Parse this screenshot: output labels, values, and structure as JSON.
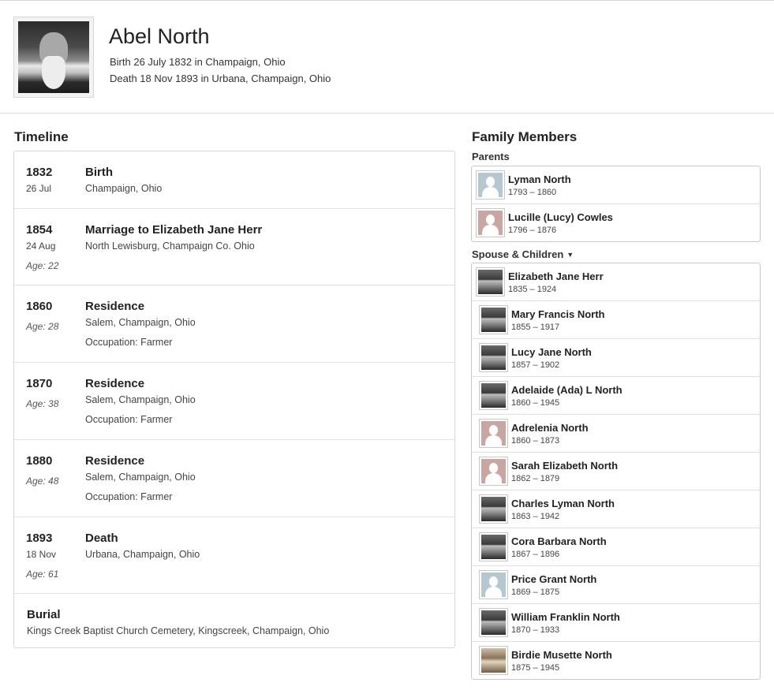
{
  "person": {
    "name": "Abel North",
    "birth": "Birth 26 July 1832 in Champaign, Ohio",
    "death": "Death 18 Nov 1893 in Urbana, Champaign, Ohio"
  },
  "timeline": {
    "title": "Timeline",
    "events": [
      {
        "year": "1832",
        "date": "26 Jul",
        "age": "",
        "title": "Birth",
        "place": "Champaign, Ohio",
        "occupation": ""
      },
      {
        "year": "1854",
        "date": "24 Aug",
        "age": "Age: 22",
        "title": "Marriage to Elizabeth Jane Herr",
        "place": "North Lewisburg, Champaign Co. Ohio",
        "occupation": ""
      },
      {
        "year": "1860",
        "date": "",
        "age": "Age: 28",
        "title": "Residence",
        "place": "Salem, Champaign, Ohio",
        "occupation": "Occupation: Farmer"
      },
      {
        "year": "1870",
        "date": "",
        "age": "Age: 38",
        "title": "Residence",
        "place": "Salem, Champaign, Ohio",
        "occupation": "Occupation: Farmer"
      },
      {
        "year": "1880",
        "date": "",
        "age": "Age: 48",
        "title": "Residence",
        "place": "Salem, Champaign, Ohio",
        "occupation": "Occupation: Farmer"
      },
      {
        "year": "1893",
        "date": "18 Nov",
        "age": "Age: 61",
        "title": "Death",
        "place": "Urbana, Champaign, Ohio",
        "occupation": ""
      }
    ],
    "burial": {
      "title": "Burial",
      "place": "Kings Creek Baptist Church Cemetery, Kingscreek, Champaign, Ohio"
    }
  },
  "family": {
    "title": "Family Members",
    "parents_label": "Parents",
    "spouse_label": "Spouse & Children",
    "spouse_caret": "▼",
    "parents": [
      {
        "name": "Lyman North",
        "dates": "1793 – 1860",
        "avatar": "male-silhouette-icon"
      },
      {
        "name": "Lucille (Lucy) Cowles",
        "dates": "1796 – 1876",
        "avatar": "female-silhouette-icon"
      }
    ],
    "spouse": {
      "name": "Elizabeth Jane Herr",
      "dates": "1835 – 1924",
      "avatar": "photo"
    },
    "children": [
      {
        "name": "Mary Francis North",
        "dates": "1855 – 1917",
        "avatar": "photo"
      },
      {
        "name": "Lucy Jane North",
        "dates": "1857 – 1902",
        "avatar": "photo"
      },
      {
        "name": "Adelaide (Ada) L North",
        "dates": "1860 – 1945",
        "avatar": "photo"
      },
      {
        "name": "Adrelenia North",
        "dates": "1860 – 1873",
        "avatar": "female-silhouette-icon"
      },
      {
        "name": "Sarah Elizabeth North",
        "dates": "1862 – 1879",
        "avatar": "female-silhouette-icon"
      },
      {
        "name": "Charles Lyman North",
        "dates": "1863 – 1942",
        "avatar": "photo"
      },
      {
        "name": "Cora Barbara North",
        "dates": "1867 – 1896",
        "avatar": "photo"
      },
      {
        "name": "Price Grant North",
        "dates": "1869 – 1875",
        "avatar": "male-silhouette-icon"
      },
      {
        "name": "William Franklin North",
        "dates": "1870 – 1933",
        "avatar": "photo"
      },
      {
        "name": "Birdie Musette North",
        "dates": "1875 – 1945",
        "avatar": "photo-sepia"
      }
    ]
  }
}
